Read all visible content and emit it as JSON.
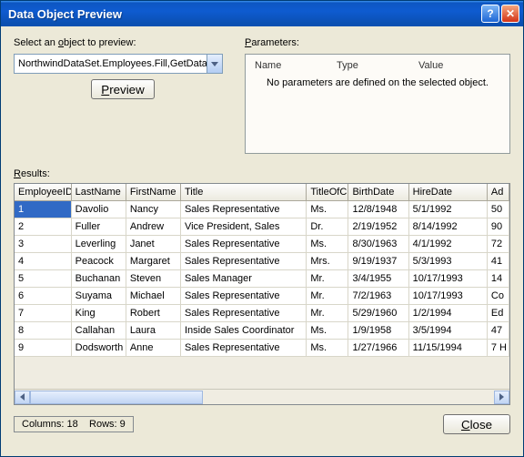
{
  "window": {
    "title": "Data Object Preview"
  },
  "object_selector": {
    "label": "Select an object to preview:",
    "value": "NorthwindDataSet.Employees.Fill,GetData ()",
    "preview_label": "Preview"
  },
  "parameters": {
    "label": "Parameters:",
    "columns": {
      "name": "Name",
      "type": "Type",
      "value": "Value"
    },
    "empty_message": "No parameters are defined on the selected object."
  },
  "results": {
    "label": "Results:",
    "columns": [
      "EmployeeID",
      "LastName",
      "FirstName",
      "Title",
      "TitleOfCourtesy",
      "BirthDate",
      "HireDate",
      "Address"
    ],
    "columns_visible": [
      "EmployeeID",
      "LastName",
      "FirstName",
      "Title",
      "TitleOfC",
      "BirthDate",
      "HireDate",
      "Ad"
    ],
    "rows": [
      {
        "EmployeeID": "1",
        "LastName": "Davolio",
        "FirstName": "Nancy",
        "Title": "Sales Representative",
        "TitleOfC": "Ms.",
        "BirthDate": "12/8/1948",
        "HireDate": "5/1/1992",
        "Ad": "50"
      },
      {
        "EmployeeID": "2",
        "LastName": "Fuller",
        "FirstName": "Andrew",
        "Title": "Vice President, Sales",
        "TitleOfC": "Dr.",
        "BirthDate": "2/19/1952",
        "HireDate": "8/14/1992",
        "Ad": "90"
      },
      {
        "EmployeeID": "3",
        "LastName": "Leverling",
        "FirstName": "Janet",
        "Title": "Sales Representative",
        "TitleOfC": "Ms.",
        "BirthDate": "8/30/1963",
        "HireDate": "4/1/1992",
        "Ad": "72"
      },
      {
        "EmployeeID": "4",
        "LastName": "Peacock",
        "FirstName": "Margaret",
        "Title": "Sales Representative",
        "TitleOfC": "Mrs.",
        "BirthDate": "9/19/1937",
        "HireDate": "5/3/1993",
        "Ad": "41"
      },
      {
        "EmployeeID": "5",
        "LastName": "Buchanan",
        "FirstName": "Steven",
        "Title": "Sales Manager",
        "TitleOfC": "Mr.",
        "BirthDate": "3/4/1955",
        "HireDate": "10/17/1993",
        "Ad": "14"
      },
      {
        "EmployeeID": "6",
        "LastName": "Suyama",
        "FirstName": "Michael",
        "Title": "Sales Representative",
        "TitleOfC": "Mr.",
        "BirthDate": "7/2/1963",
        "HireDate": "10/17/1993",
        "Ad": "Co"
      },
      {
        "EmployeeID": "7",
        "LastName": "King",
        "FirstName": "Robert",
        "Title": "Sales Representative",
        "TitleOfC": "Mr.",
        "BirthDate": "5/29/1960",
        "HireDate": "1/2/1994",
        "Ad": "Ed"
      },
      {
        "EmployeeID": "8",
        "LastName": "Callahan",
        "FirstName": "Laura",
        "Title": "Inside Sales Coordinator",
        "TitleOfC": "Ms.",
        "BirthDate": "1/9/1958",
        "HireDate": "3/5/1994",
        "Ad": "47"
      },
      {
        "EmployeeID": "9",
        "LastName": "Dodsworth",
        "FirstName": "Anne",
        "Title": "Sales Representative",
        "TitleOfC": "Ms.",
        "BirthDate": "1/27/1966",
        "HireDate": "11/15/1994",
        "Ad": "7 H"
      }
    ],
    "selected_cell": {
      "row": 0,
      "col": 0
    }
  },
  "status": {
    "columns_label": "Columns:",
    "columns_value": "18",
    "rows_label": "Rows:",
    "rows_value": "9"
  },
  "buttons": {
    "close": "Close"
  }
}
